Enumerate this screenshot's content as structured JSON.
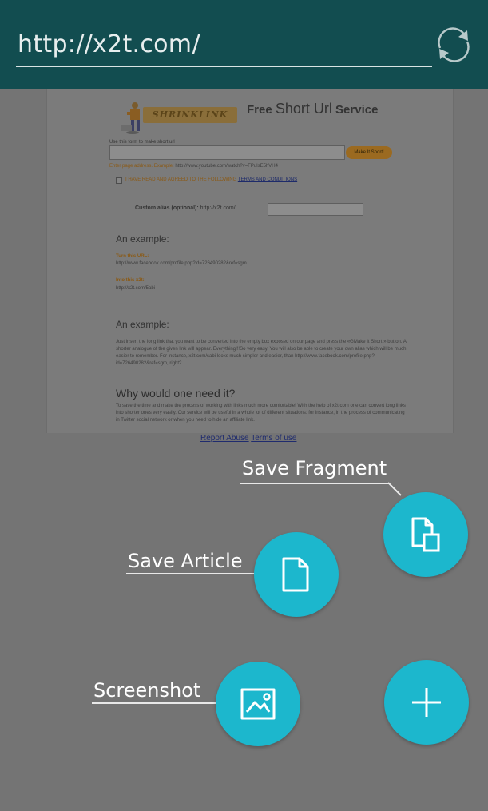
{
  "address_bar": {
    "url": "http://x2t.com/",
    "refresh_icon": "refresh-icon"
  },
  "webpage": {
    "logo_text": "SHRINKLINK",
    "title_prefix": "Free ",
    "title_big": "Short Url",
    "title_suffix": " Service",
    "form_label": "Use this form to make short url",
    "make_short_button": "Make It Short!",
    "hint_label": "Enter page address. Example: ",
    "hint_example": "http://www.youtube.com/watch?v=FPulsE5hVH4",
    "agree_text": "I HAVE READ AND AGREED TO THE FOLLOWING ",
    "terms_link": "TERMS AND CONDITIONS",
    "alias_label": "Custom alias (optional): ",
    "alias_prefix": "http://x2t.com/",
    "example1_heading": "An example:",
    "turn_label": "Turn this URL:",
    "turn_url": "http://www.facebook.com/profile.php?id=726490282&ref=sgm",
    "into_label": "Into this x2t:",
    "into_url": "http://x2t.com/5abi",
    "example2_heading": "An example:",
    "example2_text": "Just insert the long link that you want to be converted into the empty box exposed on our page and press the «GMake It Short!» button. A shorter analogue of the given link will appear. Everything!!!So very easy. You will also be able to create your own alias which will be much easier to remember. For instance, x2t.com/sabi looks much simpler and easier, than http://www.facebook.com/profile.php?id=726490282&ref=sgm, right?",
    "why_heading": "Why would one need it?",
    "why_text": "To save the time and make the process of working with links much more comfortable! With the help of x2t.com one can convert long links into shorter ones very easily. Our service will be useful in a whole lot of different situations: for instance, in the process of communicating in Twitter social network or when you need to hide an affiliate link.",
    "footer_report": "Report Abuse",
    "footer_terms": "Terms of use"
  },
  "fab_menu": {
    "save_fragment_label": "Save Fragment",
    "save_article_label": "Save Article",
    "screenshot_label": "Screenshot",
    "fab_color": "#1cb7cd"
  }
}
